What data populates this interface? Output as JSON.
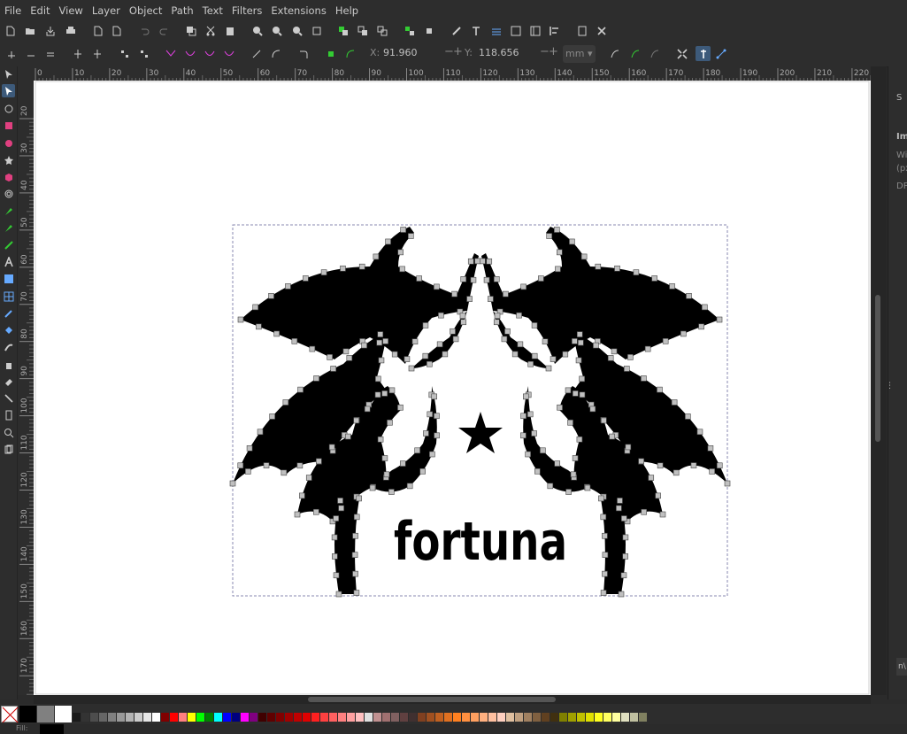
{
  "menu": [
    "File",
    "Edit",
    "View",
    "Layer",
    "Object",
    "Path",
    "Text",
    "Filters",
    "Extensions",
    "Help"
  ],
  "toolctrl": {
    "x_label": "X:",
    "x_value": "91.960",
    "y_label": "Y:",
    "y_value": "118.656",
    "unit": "mm"
  },
  "ruler": {
    "h_ticks": [
      "0",
      "10",
      "20",
      "30",
      "40",
      "50",
      "60",
      "70",
      "80",
      "90",
      "100",
      "110",
      "120",
      "130",
      "140",
      "150",
      "160",
      "170",
      "180",
      "190",
      "200",
      "210",
      "220"
    ],
    "v_ticks": [
      "20",
      "30",
      "40",
      "50",
      "60",
      "70",
      "80",
      "90",
      "100",
      "110",
      "120",
      "130",
      "140",
      "150",
      "160",
      "170"
    ]
  },
  "artwork": {
    "text": "fortuna",
    "colors": {
      "ink": "#000000",
      "node": "#c0c0c0",
      "selection_dash": "#8a8ab0"
    }
  },
  "dock": {
    "tab_partial": "S",
    "label_1": "Im",
    "label_2": "Wi",
    "label_3": "(px",
    "label_4": "DP",
    "bottom_field": "n\\"
  },
  "statusbar": {
    "fill_label": "Fill:"
  },
  "palette_colors": [
    "#000000",
    "#808080",
    "#ffffff",
    "#1a1a1a",
    "#333333",
    "#4d4d4d",
    "#666666",
    "#808080",
    "#999999",
    "#b3b3b3",
    "#cccccc",
    "#e6e6e6",
    "#ffffff",
    "#800000",
    "#ff0000",
    "#ff8080",
    "#ffff00",
    "#00ff00",
    "#008000",
    "#00ffff",
    "#0000ff",
    "#000080",
    "#ff00ff",
    "#800080",
    "#400000",
    "#600000",
    "#800000",
    "#a00000",
    "#c00000",
    "#e00000",
    "#ff2020",
    "#ff4040",
    "#ff6060",
    "#ff8080",
    "#ffa0a0",
    "#ffc0c0",
    "#e0e0e0",
    "#c09090",
    "#a07070",
    "#806060",
    "#604040",
    "#403030",
    "#804020",
    "#a05020",
    "#c06020",
    "#e07020",
    "#ff8020",
    "#ff9040",
    "#ffa060",
    "#ffb080",
    "#ffc0a0",
    "#ffd0c0",
    "#e0c0a0",
    "#c0a080",
    "#a08060",
    "#806040",
    "#604020",
    "#403010",
    "#808000",
    "#a0a000",
    "#c0c000",
    "#e0e000",
    "#ffff20",
    "#ffff60",
    "#ffffa0",
    "#e0e0c0",
    "#c0c0a0",
    "#808060"
  ]
}
